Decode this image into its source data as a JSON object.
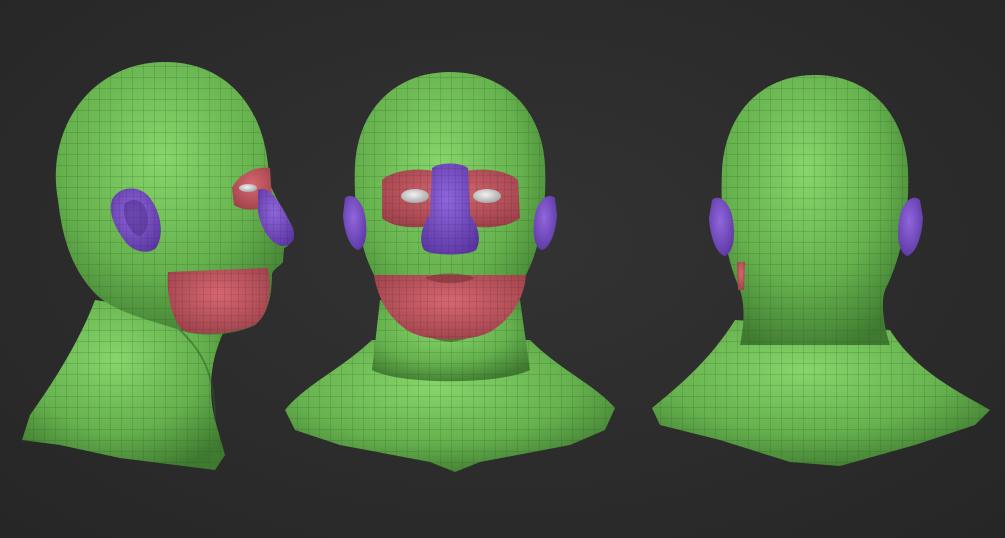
{
  "scene": {
    "background": "#2b2b2b",
    "views": [
      {
        "id": "side",
        "description_name": "side-view-head"
      },
      {
        "id": "front",
        "description_name": "front-view-head"
      },
      {
        "id": "back",
        "description_name": "back-view-head"
      }
    ],
    "polygroup_colors": {
      "skin": "#6fbf55",
      "skin_shadow": "#4f8f3c",
      "mouth_eye_group": "#c8575f",
      "nose_ear_group": "#7a4fc4",
      "eyeball": "#d8d8d8",
      "wire": "#2f5a25"
    }
  }
}
